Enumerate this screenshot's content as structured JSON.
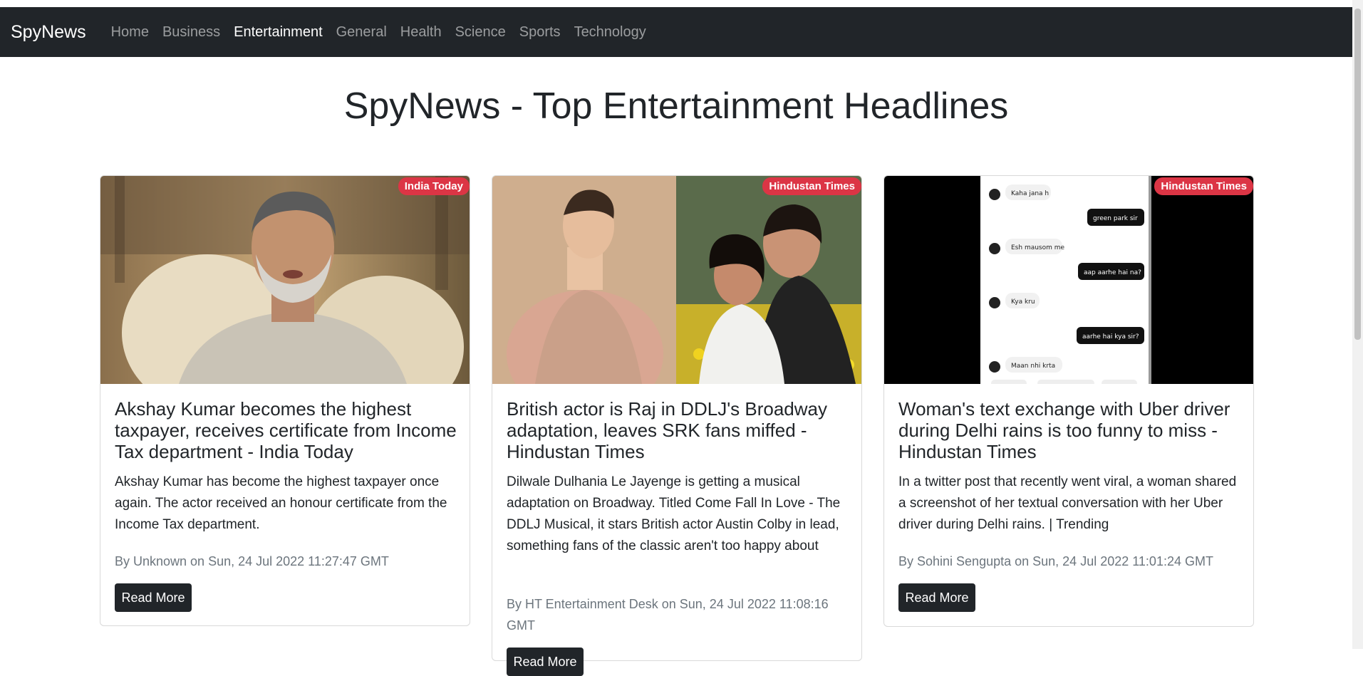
{
  "navbar": {
    "brand": "SpyNews",
    "links": [
      "Home",
      "Business",
      "Entertainment",
      "General",
      "Health",
      "Science",
      "Sports",
      "Technology"
    ],
    "active": "Entertainment"
  },
  "page": {
    "heading": "SpyNews - Top Entertainment Headlines"
  },
  "colors": {
    "navbar_bg": "#212529",
    "badge_bg": "#dc3545",
    "button_bg": "#212529"
  },
  "articles": [
    {
      "source": "India Today",
      "title": "Akshay Kumar becomes the highest taxpayer, receives certificate from Income Tax department - India Today",
      "description": "Akshay Kumar has become the highest taxpayer once again. The actor received an honour certificate from the Income Tax department.",
      "meta": "By Unknown on Sun, 24 Jul 2022 11:27:47 GMT",
      "button": "Read More"
    },
    {
      "source": "Hindustan Times",
      "title": "British actor is Raj in DDLJ's Broadway adaptation, leaves SRK fans miffed - Hindustan Times",
      "description": "Dilwale Dulhania Le Jayenge is getting a musical adaptation on Broadway. Titled Come Fall In Love - The DDLJ Musical, it stars British actor Austin Colby in lead, something fans of the classic aren't too happy about",
      "meta": "By HT Entertainment Desk on Sun, 24 Jul 2022 11:08:16 GMT",
      "button": "Read More"
    },
    {
      "source": "Hindustan Times",
      "title": "Woman's text exchange with Uber driver during Delhi rains is too funny to miss - Hindustan Times",
      "description": "In a twitter post that recently went viral, a woman shared a screenshot of her textual conversation with her Uber driver during Delhi rains. | Trending",
      "meta": "By Sohini Sengupta on Sun, 24 Jul 2022 11:01:24 GMT",
      "button": "Read More",
      "chat_messages": [
        "Kaha jana h",
        "green park sir",
        "Esh mausom me",
        "aap aarhe hai na?",
        "Kya kru",
        "aarhe hai kya sir?",
        "Maan nhi krta"
      ]
    }
  ]
}
